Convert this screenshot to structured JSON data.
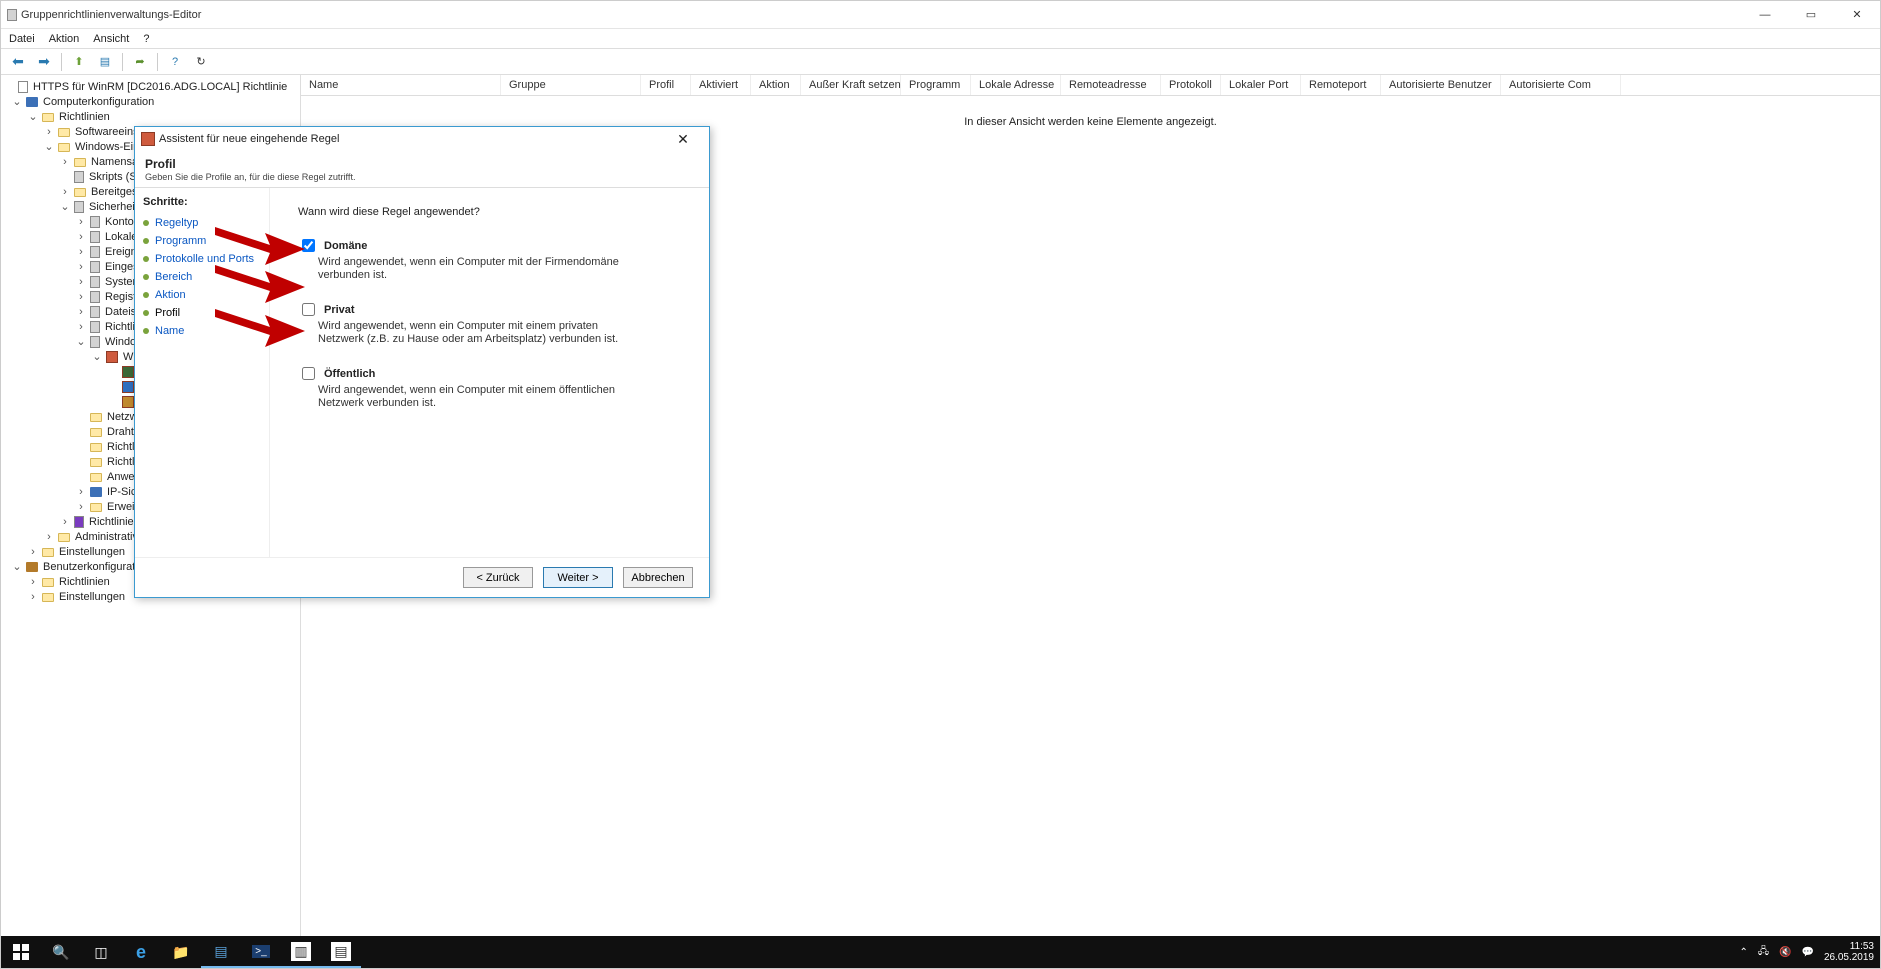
{
  "window": {
    "title": "Gruppenrichtlinienverwaltungs-Editor"
  },
  "menu": {
    "file": "Datei",
    "action": "Aktion",
    "view": "Ansicht",
    "help": "?"
  },
  "tree": {
    "root": "HTTPS für WinRM [DC2016.ADG.LOCAL] Richtlinie",
    "computer": "Computerkonfiguration",
    "policies": "Richtlinien",
    "swsettings": "Softwareeinstellungen",
    "winsettings": "Windows-Eins",
    "namens": "Namensau",
    "skripts": "Skripts (Sta",
    "bereit": "Bereitgeste",
    "sicher": "Sicherheits",
    "kontor": "Kontor",
    "lokale": "Lokale",
    "ereign": "Ereignis",
    "einges": "Eingesc",
    "system": "System",
    "registr": "Registri",
    "dateisy": "Dateisy",
    "richtli": "Richtlin",
    "windows": "Windo",
    "wir": "Wir",
    "netzwe": "Netzwe",
    "drahtlo": "Drahtlo",
    "richtlin2": "Richtlin",
    "richtlin3": "Richtlin",
    "anwen": "Anwen",
    "ipsich": "IP-Sich",
    "erweite": "Erweite",
    "richtlinien2": "Richtlinien",
    "administrative": "Administrative",
    "einstellungen": "Einstellungen",
    "user": "Benutzerkonfiguration",
    "urichtlinien": "Richtlinien",
    "ueinstellungen": "Einstellungen"
  },
  "columns": [
    "Name",
    "Gruppe",
    "Profil",
    "Aktiviert",
    "Aktion",
    "Außer Kraft setzen",
    "Programm",
    "Lokale Adresse",
    "Remoteadresse",
    "Protokoll",
    "Lokaler Port",
    "Remoteport",
    "Autorisierte Benutzer",
    "Autorisierte Com"
  ],
  "empty": "In dieser Ansicht werden keine Elemente angezeigt.",
  "modal": {
    "title": "Assistent für neue eingehende Regel",
    "heading": "Profil",
    "sub": "Geben Sie die Profile an, für die diese Regel zutrifft.",
    "stepsTitle": "Schritte:",
    "steps": [
      "Regeltyp",
      "Programm",
      "Protokolle und Ports",
      "Bereich",
      "Aktion",
      "Profil",
      "Name"
    ],
    "currentStep": 5,
    "question": "Wann wird diese Regel angewendet?",
    "opts": [
      {
        "label": "Domäne",
        "checked": true,
        "desc": "Wird angewendet, wenn ein Computer mit der Firmendomäne verbunden ist."
      },
      {
        "label": "Privat",
        "checked": false,
        "desc": "Wird angewendet, wenn ein Computer mit einem privaten Netzwerk (z.B. zu Hause oder am Arbeitsplatz) verbunden ist."
      },
      {
        "label": "Öffentlich",
        "checked": false,
        "desc": "Wird angewendet, wenn ein Computer mit einem öffentlichen Netzwerk verbunden ist."
      }
    ],
    "back": "< Zurück",
    "next": "Weiter >",
    "cancel": "Abbrechen"
  },
  "tray": {
    "time": "11:53",
    "date": "26.05.2019"
  }
}
